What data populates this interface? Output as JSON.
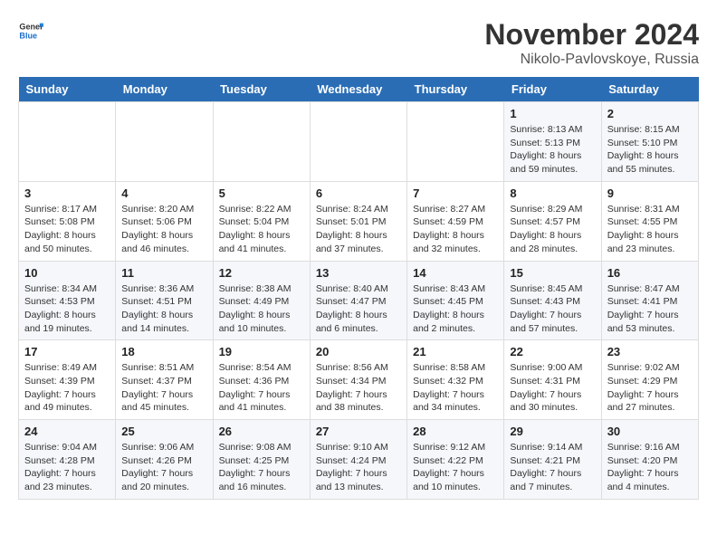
{
  "header": {
    "logo_general": "General",
    "logo_blue": "Blue",
    "month": "November 2024",
    "location": "Nikolo-Pavlovskoye, Russia"
  },
  "weekdays": [
    "Sunday",
    "Monday",
    "Tuesday",
    "Wednesday",
    "Thursday",
    "Friday",
    "Saturday"
  ],
  "weeks": [
    [
      {
        "day": "",
        "detail": ""
      },
      {
        "day": "",
        "detail": ""
      },
      {
        "day": "",
        "detail": ""
      },
      {
        "day": "",
        "detail": ""
      },
      {
        "day": "",
        "detail": ""
      },
      {
        "day": "1",
        "detail": "Sunrise: 8:13 AM\nSunset: 5:13 PM\nDaylight: 8 hours\nand 59 minutes."
      },
      {
        "day": "2",
        "detail": "Sunrise: 8:15 AM\nSunset: 5:10 PM\nDaylight: 8 hours\nand 55 minutes."
      }
    ],
    [
      {
        "day": "3",
        "detail": "Sunrise: 8:17 AM\nSunset: 5:08 PM\nDaylight: 8 hours\nand 50 minutes."
      },
      {
        "day": "4",
        "detail": "Sunrise: 8:20 AM\nSunset: 5:06 PM\nDaylight: 8 hours\nand 46 minutes."
      },
      {
        "day": "5",
        "detail": "Sunrise: 8:22 AM\nSunset: 5:04 PM\nDaylight: 8 hours\nand 41 minutes."
      },
      {
        "day": "6",
        "detail": "Sunrise: 8:24 AM\nSunset: 5:01 PM\nDaylight: 8 hours\nand 37 minutes."
      },
      {
        "day": "7",
        "detail": "Sunrise: 8:27 AM\nSunset: 4:59 PM\nDaylight: 8 hours\nand 32 minutes."
      },
      {
        "day": "8",
        "detail": "Sunrise: 8:29 AM\nSunset: 4:57 PM\nDaylight: 8 hours\nand 28 minutes."
      },
      {
        "day": "9",
        "detail": "Sunrise: 8:31 AM\nSunset: 4:55 PM\nDaylight: 8 hours\nand 23 minutes."
      }
    ],
    [
      {
        "day": "10",
        "detail": "Sunrise: 8:34 AM\nSunset: 4:53 PM\nDaylight: 8 hours\nand 19 minutes."
      },
      {
        "day": "11",
        "detail": "Sunrise: 8:36 AM\nSunset: 4:51 PM\nDaylight: 8 hours\nand 14 minutes."
      },
      {
        "day": "12",
        "detail": "Sunrise: 8:38 AM\nSunset: 4:49 PM\nDaylight: 8 hours\nand 10 minutes."
      },
      {
        "day": "13",
        "detail": "Sunrise: 8:40 AM\nSunset: 4:47 PM\nDaylight: 8 hours\nand 6 minutes."
      },
      {
        "day": "14",
        "detail": "Sunrise: 8:43 AM\nSunset: 4:45 PM\nDaylight: 8 hours\nand 2 minutes."
      },
      {
        "day": "15",
        "detail": "Sunrise: 8:45 AM\nSunset: 4:43 PM\nDaylight: 7 hours\nand 57 minutes."
      },
      {
        "day": "16",
        "detail": "Sunrise: 8:47 AM\nSunset: 4:41 PM\nDaylight: 7 hours\nand 53 minutes."
      }
    ],
    [
      {
        "day": "17",
        "detail": "Sunrise: 8:49 AM\nSunset: 4:39 PM\nDaylight: 7 hours\nand 49 minutes."
      },
      {
        "day": "18",
        "detail": "Sunrise: 8:51 AM\nSunset: 4:37 PM\nDaylight: 7 hours\nand 45 minutes."
      },
      {
        "day": "19",
        "detail": "Sunrise: 8:54 AM\nSunset: 4:36 PM\nDaylight: 7 hours\nand 41 minutes."
      },
      {
        "day": "20",
        "detail": "Sunrise: 8:56 AM\nSunset: 4:34 PM\nDaylight: 7 hours\nand 38 minutes."
      },
      {
        "day": "21",
        "detail": "Sunrise: 8:58 AM\nSunset: 4:32 PM\nDaylight: 7 hours\nand 34 minutes."
      },
      {
        "day": "22",
        "detail": "Sunrise: 9:00 AM\nSunset: 4:31 PM\nDaylight: 7 hours\nand 30 minutes."
      },
      {
        "day": "23",
        "detail": "Sunrise: 9:02 AM\nSunset: 4:29 PM\nDaylight: 7 hours\nand 27 minutes."
      }
    ],
    [
      {
        "day": "24",
        "detail": "Sunrise: 9:04 AM\nSunset: 4:28 PM\nDaylight: 7 hours\nand 23 minutes."
      },
      {
        "day": "25",
        "detail": "Sunrise: 9:06 AM\nSunset: 4:26 PM\nDaylight: 7 hours\nand 20 minutes."
      },
      {
        "day": "26",
        "detail": "Sunrise: 9:08 AM\nSunset: 4:25 PM\nDaylight: 7 hours\nand 16 minutes."
      },
      {
        "day": "27",
        "detail": "Sunrise: 9:10 AM\nSunset: 4:24 PM\nDaylight: 7 hours\nand 13 minutes."
      },
      {
        "day": "28",
        "detail": "Sunrise: 9:12 AM\nSunset: 4:22 PM\nDaylight: 7 hours\nand 10 minutes."
      },
      {
        "day": "29",
        "detail": "Sunrise: 9:14 AM\nSunset: 4:21 PM\nDaylight: 7 hours\nand 7 minutes."
      },
      {
        "day": "30",
        "detail": "Sunrise: 9:16 AM\nSunset: 4:20 PM\nDaylight: 7 hours\nand 4 minutes."
      }
    ]
  ]
}
